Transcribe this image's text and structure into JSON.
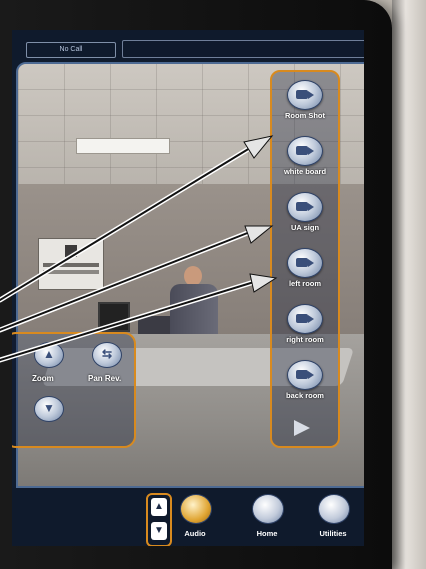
{
  "header": {
    "call_status": "No Call"
  },
  "camera_presets": [
    {
      "label": "Room Shot"
    },
    {
      "label": "white board"
    },
    {
      "label": "UA sign"
    },
    {
      "label": "left room"
    },
    {
      "label": "right room"
    },
    {
      "label": "back room"
    }
  ],
  "camera_controls": {
    "zoom_label": "Zoom",
    "pan_rev_label": "Pan Rev."
  },
  "bottom_bar": {
    "audio_label": "Audio",
    "home_label": "Home",
    "utilities_label": "Utilities"
  },
  "colors": {
    "accent_orange": "#d88a1f",
    "screen_bg": "#101c2e",
    "button_blue": "#6f84a5"
  },
  "icons": {
    "camera_preset": "video-camera-icon",
    "next": "play-right-icon",
    "audio": "muted-speaker-icon",
    "home": "house-icon",
    "utilities": "tools-icon",
    "pan_rev": "swap-arrows-icon"
  }
}
